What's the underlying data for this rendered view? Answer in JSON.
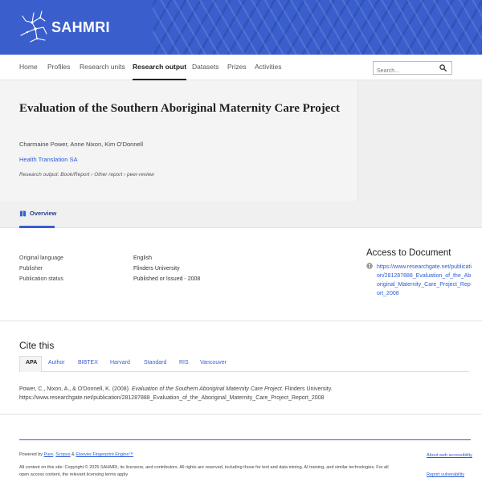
{
  "header": {
    "logo_text": "SAHMRI",
    "brand_color": "#3a5fcd"
  },
  "nav": {
    "items": [
      {
        "label": "Home"
      },
      {
        "label": "Profiles"
      },
      {
        "label": "Research units"
      },
      {
        "label": "Research output",
        "active": true
      },
      {
        "label": "Datasets"
      },
      {
        "label": "Prizes"
      },
      {
        "label": "Activities"
      }
    ],
    "search_placeholder": "Search...",
    "search_icon": "magnifier-icon"
  },
  "publication": {
    "title": "Evaluation of the Southern Aboriginal Maternity Care Project",
    "authors": "Charmaine Power, Anne Nixon, Kim O'Donnell",
    "organisation": "Health Translation SA",
    "output_type": "Research output: Book/Report › Other report › peer-review"
  },
  "tabs": {
    "overview_label": "Overview",
    "overview_icon": "book-icon"
  },
  "details": {
    "rows": [
      {
        "label": "Original language",
        "value": "English"
      },
      {
        "label": "Publisher",
        "value": "Flinders University"
      },
      {
        "label": "Publication status",
        "value": "Published or Issued - 2008"
      }
    ]
  },
  "access": {
    "title": "Access to Document",
    "icon": "globe-icon",
    "link": "https://www.researchgate.net/publication/281287888_Evaluation_of_the_Aboriginal_Maternity_Care_Project_Report_2008"
  },
  "cite": {
    "title": "Cite this",
    "tabs": [
      "APA",
      "Author",
      "BIBTEX",
      "Harvard",
      "Standard",
      "RIS",
      "Vancouver"
    ],
    "active_tab": "APA",
    "text_prefix": "Power, C., Nixon, A., & O'Donnell, K. (2008). ",
    "text_title": "Evaluation of the Southern Aboriginal Maternity Care Project.",
    "text_suffix": " Flinders University.",
    "text_url": "https://www.researchgate.net/publication/281287888_Evaluation_of_the_Aboriginal_Maternity_Care_Project_Report_2008"
  },
  "footer": {
    "powered_prefix": "Powered by ",
    "powered_pure": "Pure",
    "powered_sep1": ", ",
    "powered_scopus": "Scopus",
    "powered_sep2": " & ",
    "powered_engine": "Elsevier Fingerprint Engine™",
    "copyright": "All content on this site: Copyright © 2025 SAHMRI, its licensors, and contributors. All rights are reserved, including those for text and data mining, AI training, and similar technologies. For all open access content, the relevant licensing terms apply",
    "accessibility_link": "About web accessibility",
    "vulnerability_link": "Report vulnerability"
  }
}
